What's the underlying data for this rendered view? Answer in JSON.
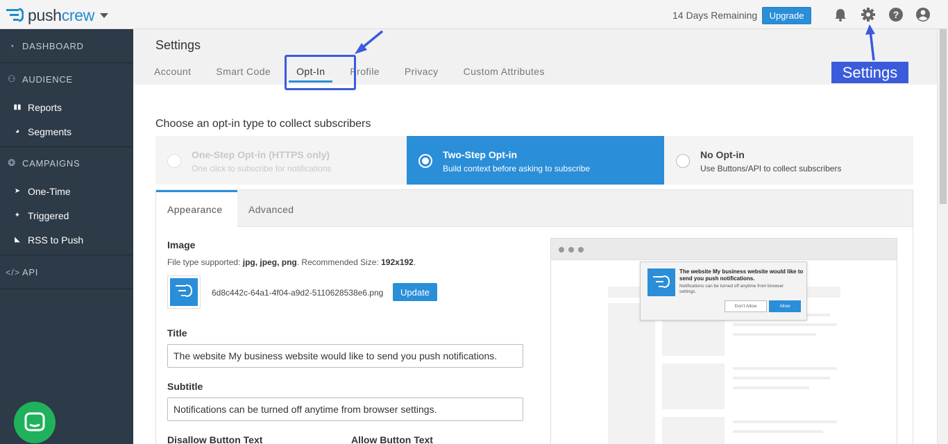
{
  "brand": {
    "name_part1": "push",
    "name_part2": "crew"
  },
  "topbar": {
    "trial_text": "14 Days Remaining",
    "upgrade_label": "Upgrade",
    "icons": [
      "bell-icon",
      "gear-icon",
      "help-icon",
      "user-icon"
    ]
  },
  "annotations": {
    "settings_label": "Settings",
    "color": "#3b5bdb"
  },
  "sidebar": {
    "dashboard": "DASHBOARD",
    "audience": "AUDIENCE",
    "audience_items": [
      "Reports",
      "Segments"
    ],
    "campaigns": "CAMPAIGNS",
    "campaign_items": [
      "One-Time",
      "Triggered",
      "RSS to Push"
    ],
    "api": "API"
  },
  "page": {
    "title": "Settings",
    "tabs": [
      "Account",
      "Smart Code",
      "Opt-In",
      "Profile",
      "Privacy",
      "Custom Attributes"
    ],
    "active_tab": "Opt-In"
  },
  "optin": {
    "heading": "Choose an opt-in type to collect subscribers",
    "options": [
      {
        "title": "One-Step Opt-in (HTTPS only)",
        "subtitle": "One click to subscribe for notifications",
        "state": "disabled"
      },
      {
        "title": "Two-Step Opt-in",
        "subtitle": "Build context before asking to subscribe",
        "state": "selected"
      },
      {
        "title": "No Opt-in",
        "subtitle": "Use Buttons/API to collect subscribers",
        "state": "normal"
      }
    ]
  },
  "panel": {
    "tabs": [
      "Appearance",
      "Advanced"
    ],
    "active_tab": "Appearance",
    "image_label": "Image",
    "file_hint_prefix": "File type supported: ",
    "file_types": "jpg, jpeg, png",
    "size_prefix": ". Recommended Size: ",
    "size_value": "192x192",
    "size_suffix": ".",
    "filename": "6d8c442c-64a1-4f04-a9d2-5110628538e6.png",
    "update_label": "Update",
    "title_label": "Title",
    "title_value": "The website My business website would like to send you push notifications.",
    "subtitle_label": "Subtitle",
    "subtitle_value": "Notifications can be turned off anytime from browser settings.",
    "disallow_label": "Disallow Button Text",
    "allow_label": "Allow Button Text"
  },
  "preview": {
    "title": "The website My business website would like to send you push notifications.",
    "subtitle": "Notifications can be turned off anytime from browser settings.",
    "deny": "Don't Allow",
    "allow": "Allow"
  },
  "colors": {
    "accent": "#2a8ed8",
    "sidebar": "#2d3a47",
    "chat": "#1fb15c"
  }
}
